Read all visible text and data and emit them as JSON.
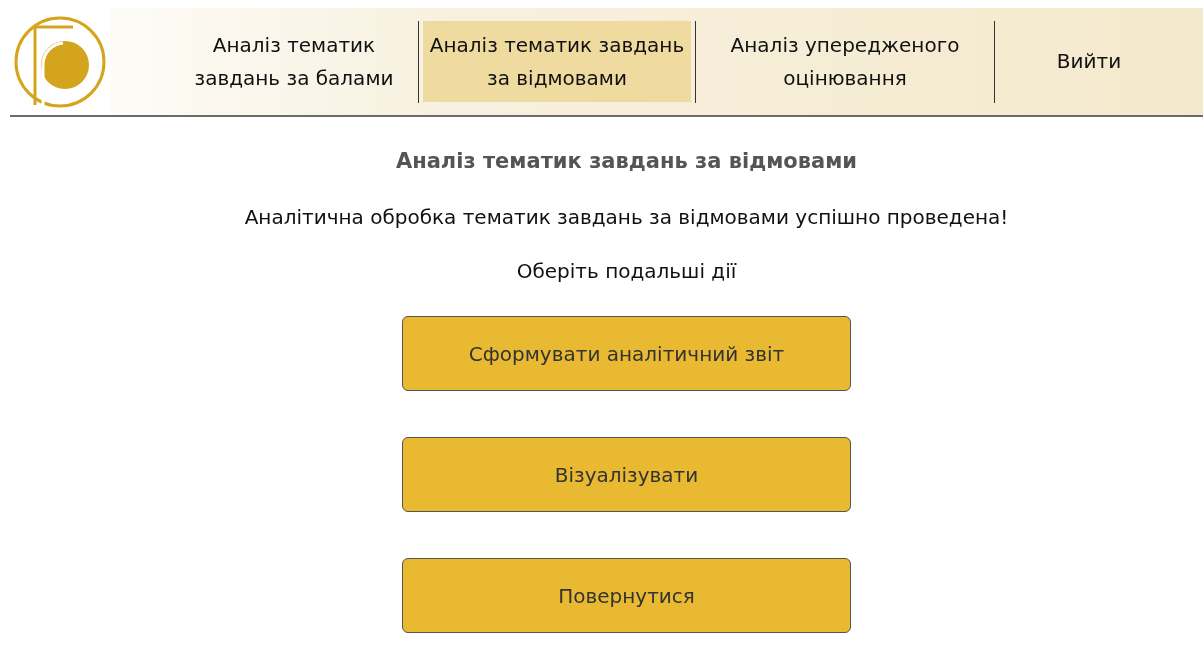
{
  "nav": {
    "items": [
      {
        "label": "Аналіз тематик завдань за балами",
        "selected": false
      },
      {
        "label": "Аналіз тематик завдань за відмовами",
        "selected": true
      },
      {
        "label": "Аналіз упередженого оцінювання",
        "selected": false
      },
      {
        "label": "Вийти",
        "selected": false
      }
    ]
  },
  "main": {
    "title": "Аналіз тематик завдань за відмовами",
    "message": "Аналітична обробка тематик завдань за відмовами успішно проведена!",
    "prompt": "Оберіть подальші дії",
    "buttons": [
      "Сформувати аналітичний звіт",
      "Візуалізувати",
      "Повернутися"
    ]
  }
}
